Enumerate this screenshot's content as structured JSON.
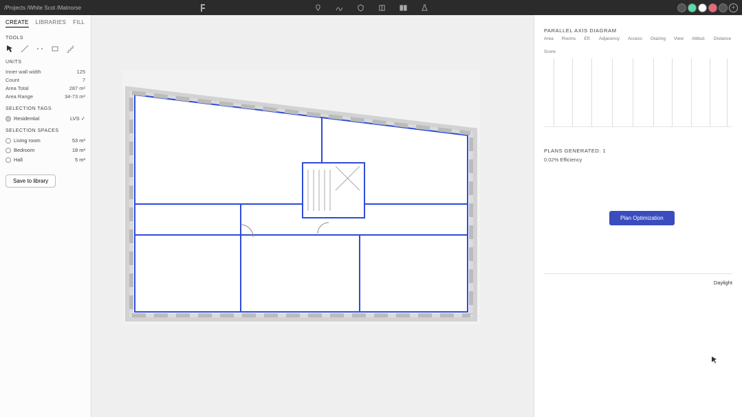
{
  "breadcrumb": [
    "/Projects",
    "/White Scot",
    "/Matnorse"
  ],
  "topbarAvatars": 5,
  "leftTabs": {
    "create": "CREATE",
    "libraries": "LIBRARIES",
    "fill": "FILL"
  },
  "sections": {
    "toolsLabel": "TOOLS",
    "unitsLabel": "UNITS",
    "units": [
      {
        "k": "Inner wall width",
        "v": "125"
      },
      {
        "k": "Count",
        "v": "7"
      },
      {
        "k": "Area Total",
        "v": "287 m²"
      },
      {
        "k": "Area Range",
        "v": "34-73 m²"
      }
    ],
    "selTags": "SELECTION TAGS",
    "tags": [
      {
        "label": "Residential",
        "check": "LVS",
        "ext": "✓"
      }
    ],
    "selSpaces": "SELECTION SPACES",
    "spaces": [
      {
        "label": "Living room",
        "v": "53 m²"
      },
      {
        "label": "Bedroom",
        "v": "18 m²"
      },
      {
        "label": "Hall",
        "v": "5 m²"
      }
    ],
    "saveBtn": "Save to library"
  },
  "right": {
    "header": "PARALLEL AXIS DIAGRAM",
    "axes": [
      "Area",
      "Rooms",
      "Eff.",
      "Adjacency",
      "Access",
      "Glazing",
      "View",
      "Altitud.",
      "Distance",
      "Score"
    ],
    "plansGenerated": "PLANS GENERATED: 1",
    "efficiency": "0.02% Efficiency",
    "planBtn": "Plan Optimization",
    "daylight": "Daylight"
  }
}
